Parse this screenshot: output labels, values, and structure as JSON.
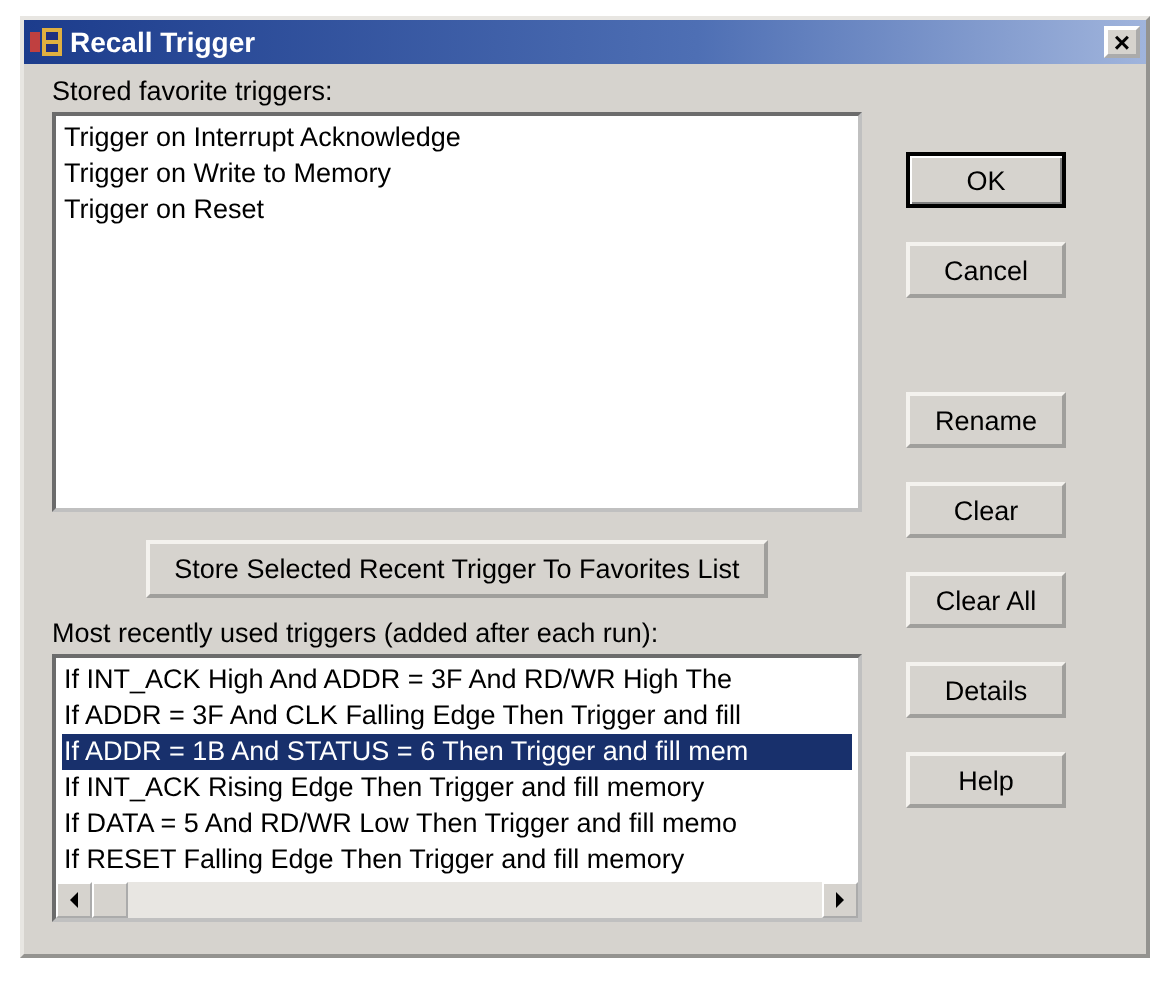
{
  "window": {
    "title": "Recall Trigger",
    "close": "×"
  },
  "favorites": {
    "label": "Stored favorite triggers:",
    "items": [
      {
        "text": "Trigger on Interrupt Acknowledge",
        "selected": false
      },
      {
        "text": "Trigger on Write to Memory",
        "selected": false
      },
      {
        "text": "Trigger on Reset",
        "selected": false
      }
    ]
  },
  "store_button": "Store Selected Recent Trigger To Favorites List",
  "recent": {
    "label": "Most recently used triggers (added after each run):",
    "items": [
      {
        "text": "If INT_ACK High And ADDR = 3F And RD/WR High The",
        "selected": false
      },
      {
        "text": "If ADDR = 3F And CLK Falling Edge Then Trigger and fill",
        "selected": false
      },
      {
        "text": "If ADDR = 1B And STATUS = 6 Then Trigger and fill mem",
        "selected": true
      },
      {
        "text": "If INT_ACK Rising Edge Then Trigger and fill memory",
        "selected": false
      },
      {
        "text": "If DATA = 5 And RD/WR Low Then Trigger and fill memo",
        "selected": false
      },
      {
        "text": "If RESET Falling Edge Then Trigger and fill memory",
        "selected": false
      }
    ]
  },
  "buttons": [
    {
      "label": "OK",
      "kind": "default"
    },
    {
      "label": "Cancel",
      "kind": "normal"
    },
    {
      "label": "Rename",
      "kind": "normal"
    },
    {
      "label": "Clear",
      "kind": "normal"
    },
    {
      "label": "Clear All",
      "kind": "normal"
    },
    {
      "label": "Details",
      "kind": "normal"
    },
    {
      "label": "Help",
      "kind": "normal"
    }
  ]
}
